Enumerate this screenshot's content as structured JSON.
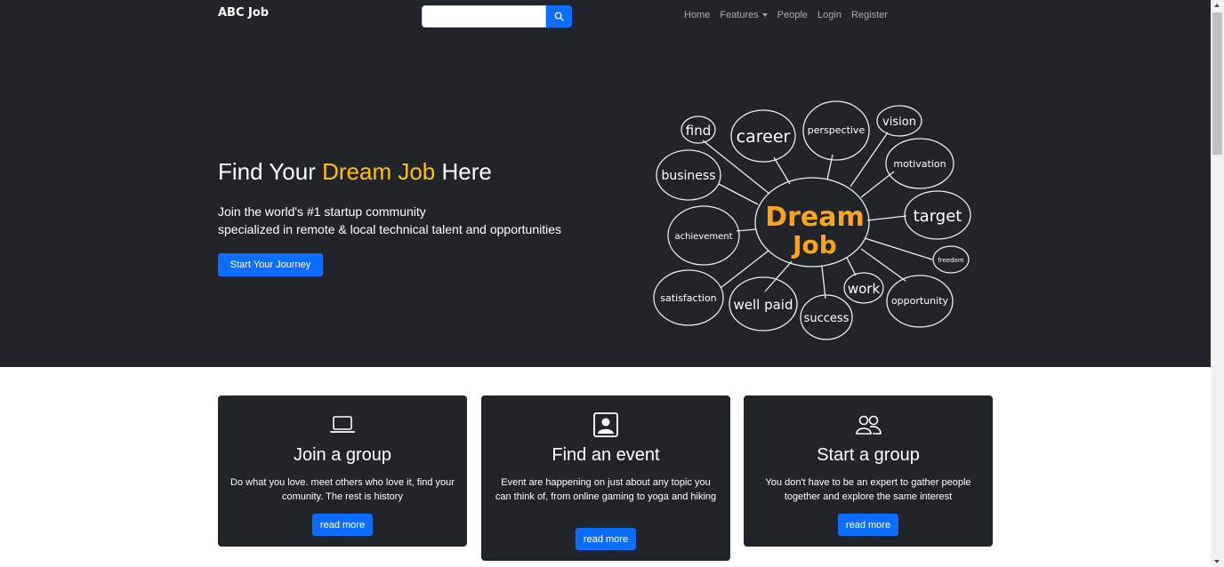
{
  "navbar": {
    "brand": "ABC Job",
    "search": {
      "placeholder": "",
      "value": ""
    },
    "links": [
      {
        "label": "Home"
      },
      {
        "label": "Features"
      },
      {
        "label": "People"
      },
      {
        "label": "Login"
      },
      {
        "label": "Register"
      }
    ]
  },
  "hero": {
    "title_pre": "Find Your ",
    "title_accent": "Dream Job",
    "title_post": " Here",
    "subtitle_line1": "Join the world's #1 startup community",
    "subtitle_line2": "specialized in remote & local technical talent and opportunities",
    "cta_label": "Start Your Journey"
  },
  "mindmap": {
    "center_line1": "Dream",
    "center_line2": "Job",
    "words": [
      "find",
      "career",
      "perspective",
      "vision",
      "business",
      "motivation",
      "target",
      "achievement",
      "freedom",
      "work",
      "satisfaction",
      "well paid",
      "success",
      "opportunity"
    ]
  },
  "cards": [
    {
      "icon": "laptop-icon",
      "title": "Join a group",
      "text": "Do what you love. meet others who love it, find your comunity. The rest is history",
      "button": "read more"
    },
    {
      "icon": "person-portrait-icon",
      "title": "Find an event",
      "text": "Event are happening on just about any topic you can think of, from online gaming to yoga and hiking",
      "button": "read more"
    },
    {
      "icon": "people-icon",
      "title": "Start a group",
      "text": "You don't have to be an expert to gather people together and explore the same interest",
      "button": "read more"
    }
  ],
  "colors": {
    "dark_bg": "#212529",
    "accent_yellow": "#ffc107",
    "primary_blue": "#0d6efd",
    "mindmap_center": "#f7a51c"
  }
}
